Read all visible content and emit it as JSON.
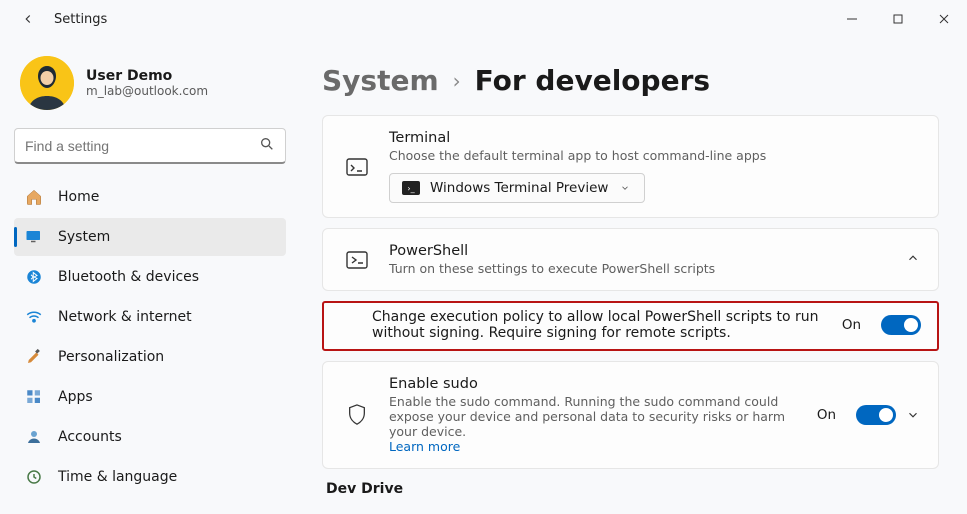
{
  "window": {
    "title": "Settings"
  },
  "profile": {
    "name": "User Demo",
    "email": "m_lab@outlook.com"
  },
  "search": {
    "placeholder": "Find a setting"
  },
  "nav": {
    "items": [
      {
        "label": "Home"
      },
      {
        "label": "System"
      },
      {
        "label": "Bluetooth & devices"
      },
      {
        "label": "Network & internet"
      },
      {
        "label": "Personalization"
      },
      {
        "label": "Apps"
      },
      {
        "label": "Accounts"
      },
      {
        "label": "Time & language"
      }
    ]
  },
  "breadcrumb": {
    "parent": "System",
    "current": "For developers"
  },
  "terminal": {
    "title": "Terminal",
    "subtitle": "Choose the default terminal app to host command-line apps",
    "selected": "Windows Terminal Preview"
  },
  "powershell": {
    "title": "PowerShell",
    "subtitle": "Turn on these settings to execute PowerShell scripts",
    "policy_text": "Change execution policy to allow local PowerShell scripts to run without signing. Require signing for remote scripts.",
    "policy_state": "On"
  },
  "sudo": {
    "title": "Enable sudo",
    "subtitle": "Enable the sudo command. Running the sudo command could expose your device and personal data to security risks or harm your device.",
    "learn_more": "Learn more",
    "state": "On"
  },
  "devdrive": {
    "heading": "Dev Drive"
  }
}
